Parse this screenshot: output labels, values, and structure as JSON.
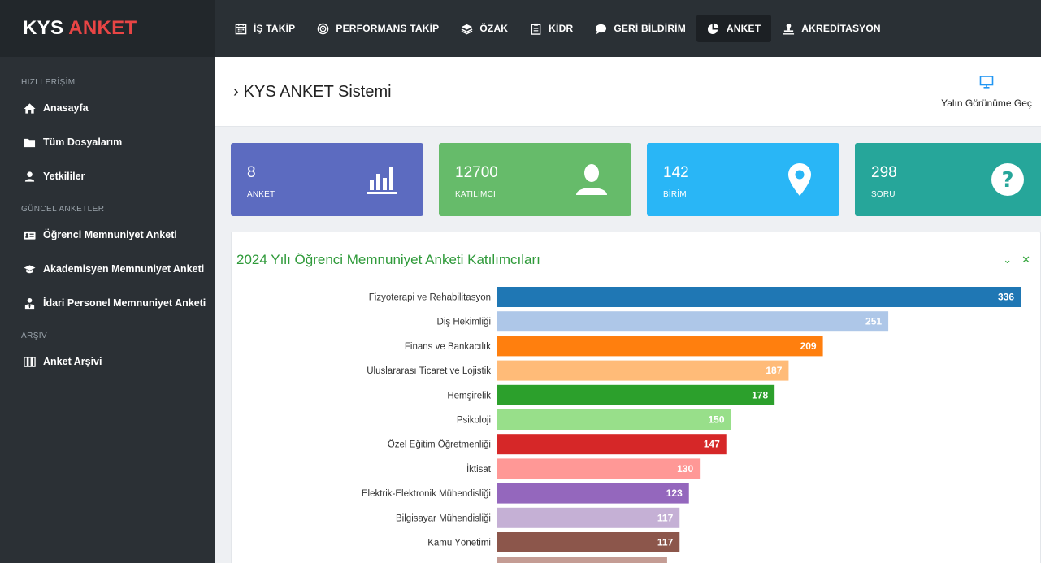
{
  "brand": {
    "part1": "KYS",
    "part2": "ANKET"
  },
  "nav": [
    {
      "label": "İŞ TAKİP",
      "icon": "calendar-icon"
    },
    {
      "label": "PERFORMANS TAKİP",
      "icon": "target-icon"
    },
    {
      "label": "ÖZAK",
      "icon": "layers-icon"
    },
    {
      "label": "KİDR",
      "icon": "clipboard-icon"
    },
    {
      "label": "GERİ BİLDİRİM",
      "icon": "comment-icon"
    },
    {
      "label": "ANKET",
      "icon": "pie-chart-icon",
      "active": true
    },
    {
      "label": "AKREDİTASYON",
      "icon": "stamp-icon"
    }
  ],
  "sidebar": {
    "sections": [
      {
        "title": "HIZLI ERİŞİM",
        "items": [
          {
            "label": "Anasayfa",
            "icon": "home-icon"
          },
          {
            "label": "Tüm Dosyalarım",
            "icon": "folder-icon"
          },
          {
            "label": "Yetkililer",
            "icon": "user-icon"
          }
        ]
      },
      {
        "title": "GÜNCEL ANKETLER",
        "items": [
          {
            "label": "Öğrenci Memnuniyet Anketi",
            "icon": "id-card-icon"
          },
          {
            "label": "Akademisyen Memnuniyet Anketi",
            "icon": "graduation-cap-icon"
          },
          {
            "label": "İdari Personel Memnuniyet Anketi",
            "icon": "user-tie-icon"
          }
        ]
      },
      {
        "title": "ARŞİV",
        "items": [
          {
            "label": "Anket Arşivi",
            "icon": "archive-icon"
          }
        ]
      }
    ]
  },
  "header": {
    "title": "KYS ANKET Sistemi",
    "view_toggle": "Yalın Görünüme Geç"
  },
  "stats": [
    {
      "value": "8",
      "label": "ANKET",
      "color": "#5c6bc0",
      "icon": "bar-chart-icon"
    },
    {
      "value": "12700",
      "label": "KATILIMCI",
      "color": "#66bb6a",
      "icon": "user-icon"
    },
    {
      "value": "142",
      "label": "BİRİM",
      "color": "#29b6f6",
      "icon": "map-marker-icon"
    },
    {
      "value": "298",
      "label": "SORU",
      "color": "#26a69a",
      "icon": "question-icon"
    }
  ],
  "panel": {
    "title": "2024 Yılı Öğrenci Memnuniyet Anketi Katılımcıları",
    "collapse_icon": "chevron-down-icon",
    "close_icon": "close-icon"
  },
  "chart_data": {
    "type": "bar",
    "orientation": "horizontal",
    "title": "2024 Yılı Öğrenci Memnuniyet Anketi Katılımcıları",
    "categories": [
      "Fizyoterapi ve Rehabilitasyon",
      "Diş Hekimliği",
      "Finans ve Bankacılık",
      "Uluslararası Ticaret ve Lojistik",
      "Hemşirelik",
      "Psikoloji",
      "Özel Eğitim Öğretmenliği",
      "İktisat",
      "Elektrik-Elektronik Mühendisliği",
      "Bilgisayar Mühendisliği",
      "Kamu Yönetimi",
      ""
    ],
    "values": [
      336,
      251,
      209,
      187,
      178,
      150,
      147,
      130,
      123,
      117,
      117,
      109
    ],
    "colors": [
      "#1f77b4",
      "#aec7e8",
      "#ff7f0e",
      "#ffbb78",
      "#2ca02c",
      "#98df8a",
      "#d62728",
      "#ff9896",
      "#9467bd",
      "#c5b0d5",
      "#8c564b",
      "#c49c94"
    ],
    "xlim": [
      0,
      336
    ],
    "grid": false,
    "legend": "none"
  }
}
